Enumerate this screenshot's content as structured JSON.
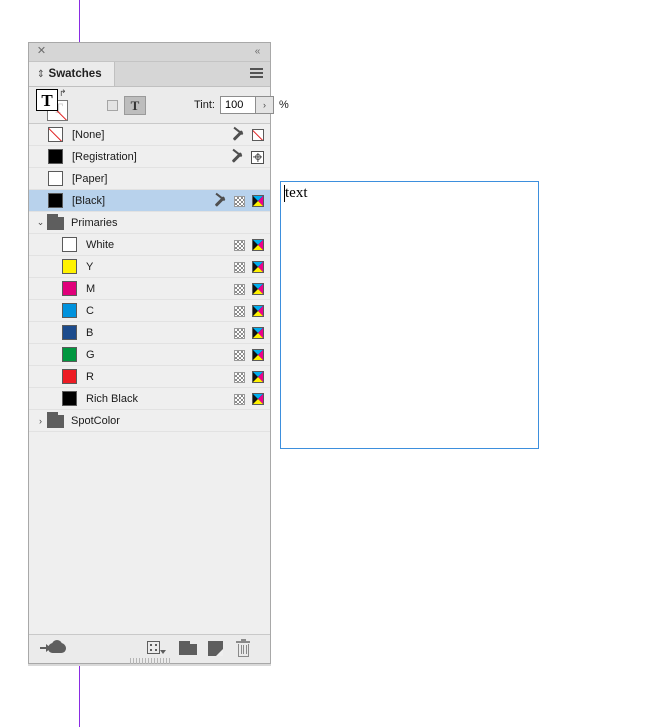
{
  "app": {
    "panel_title": "Swatches"
  },
  "titlebar": {
    "close_label": "✕",
    "collapse_label": "«"
  },
  "tab": {
    "grip_glyph": "⇕",
    "label": "Swatches",
    "menu_name": "panel-menu"
  },
  "options": {
    "fill_glyph": "T",
    "stroke_glyph": "T",
    "swap_glyph": "↱",
    "format_container_label": "T",
    "tint_label": "Tint:",
    "tint_value": "100",
    "tint_placeholder": "100",
    "tint_stepper_glyph": "›",
    "tint_percent": "%"
  },
  "swatches": [
    {
      "name": "[None]",
      "chip": "none",
      "chip_color": "#ffffff",
      "indent": false,
      "selected": false,
      "icons": [
        "dropper",
        "nonebox"
      ]
    },
    {
      "name": "[Registration]",
      "chip": "solid",
      "chip_color": "#000000",
      "indent": false,
      "selected": false,
      "icons": [
        "dropper",
        "registration"
      ]
    },
    {
      "name": "[Paper]",
      "chip": "solid",
      "chip_color": "#ffffff",
      "indent": false,
      "selected": false,
      "icons": []
    },
    {
      "name": "[Black]",
      "chip": "solid",
      "chip_color": "#000000",
      "indent": false,
      "selected": true,
      "icons": [
        "dropper",
        "checker",
        "cmyk"
      ]
    },
    {
      "name": "Primaries",
      "chip": "group",
      "twisty": "⌄",
      "indent": false,
      "selected": false,
      "icons": []
    },
    {
      "name": "White",
      "chip": "solid",
      "chip_color": "#ffffff",
      "indent": true,
      "selected": false,
      "icons": [
        "checker",
        "cmyk"
      ]
    },
    {
      "name": "Y",
      "chip": "solid",
      "chip_color": "#fff200",
      "indent": true,
      "selected": false,
      "icons": [
        "checker",
        "cmyk"
      ]
    },
    {
      "name": "M",
      "chip": "solid",
      "chip_color": "#e0007a",
      "indent": true,
      "selected": false,
      "icons": [
        "checker",
        "cmyk"
      ]
    },
    {
      "name": "C",
      "chip": "solid",
      "chip_color": "#0092dd",
      "indent": true,
      "selected": false,
      "icons": [
        "checker",
        "cmyk"
      ]
    },
    {
      "name": "B",
      "chip": "solid",
      "chip_color": "#1c4b8c",
      "indent": true,
      "selected": false,
      "icons": [
        "checker",
        "cmyk"
      ]
    },
    {
      "name": "G",
      "chip": "solid",
      "chip_color": "#00973f",
      "indent": true,
      "selected": false,
      "icons": [
        "checker",
        "cmyk"
      ]
    },
    {
      "name": "R",
      "chip": "solid",
      "chip_color": "#ed1c24",
      "indent": true,
      "selected": false,
      "icons": [
        "checker",
        "cmyk"
      ]
    },
    {
      "name": "Rich Black",
      "chip": "solid",
      "chip_color": "#000000",
      "indent": true,
      "selected": false,
      "icons": [
        "checker",
        "cmyk"
      ]
    },
    {
      "name": "SpotColor",
      "chip": "group",
      "twisty": "›",
      "indent": false,
      "selected": false,
      "icons": []
    }
  ],
  "footer": {
    "buttons": [
      {
        "name": "cc-library-button",
        "title": "Add to CC Library"
      },
      {
        "name": "new-color-group-button",
        "title": "New Color Group"
      },
      {
        "name": "new-folder-button",
        "title": "New Folder"
      },
      {
        "name": "new-swatch-button",
        "title": "New Swatch"
      },
      {
        "name": "delete-swatch-button",
        "title": "Delete Swatch"
      }
    ]
  },
  "canvas": {
    "text_frame_content": "text",
    "guide_color": "#8a2be2",
    "frame_border_color": "#3d8fdd"
  }
}
